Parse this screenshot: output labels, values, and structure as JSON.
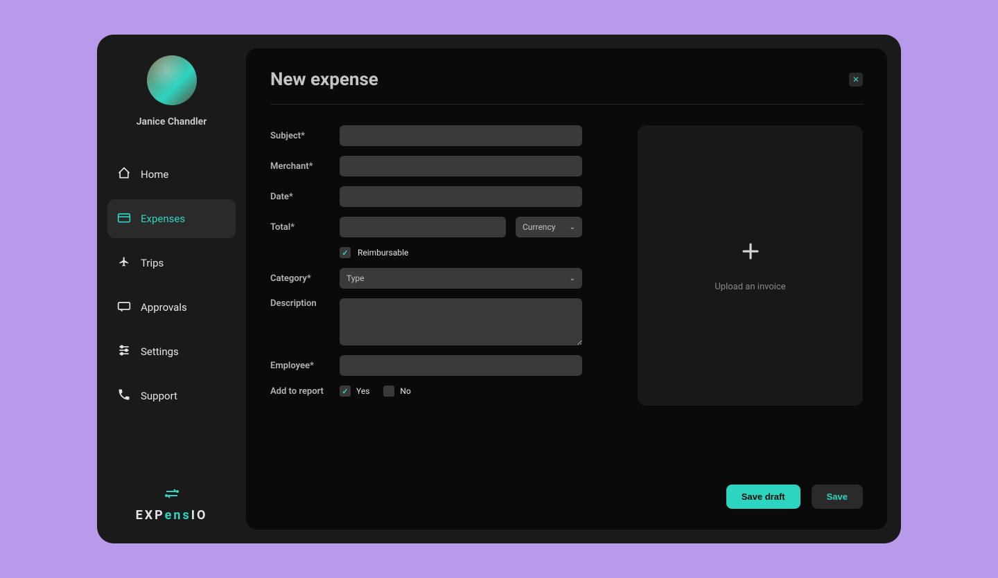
{
  "user": {
    "name": "Janice Chandler"
  },
  "nav": {
    "items": [
      {
        "label": "Home"
      },
      {
        "label": "Expenses"
      },
      {
        "label": "Trips"
      },
      {
        "label": "Approvals"
      },
      {
        "label": "Settings"
      },
      {
        "label": "Support"
      }
    ]
  },
  "logo": {
    "prefix": "EXP",
    "accent": "ens",
    "suffix": "IO"
  },
  "page": {
    "title": "New expense"
  },
  "form": {
    "subject_label": "Subject*",
    "merchant_label": "Merchant*",
    "date_label": "Date*",
    "total_label": "Total*",
    "currency_placeholder": "Currency",
    "reimbursable_label": "Reimbursable",
    "category_label": "Category*",
    "category_placeholder": "Type",
    "description_label": "Description",
    "employee_label": "Employee*",
    "add_to_report_label": "Add to report",
    "yes_label": "Yes",
    "no_label": "No"
  },
  "upload": {
    "text": "Upload an invoice"
  },
  "actions": {
    "save_draft": "Save draft",
    "save": "Save"
  }
}
